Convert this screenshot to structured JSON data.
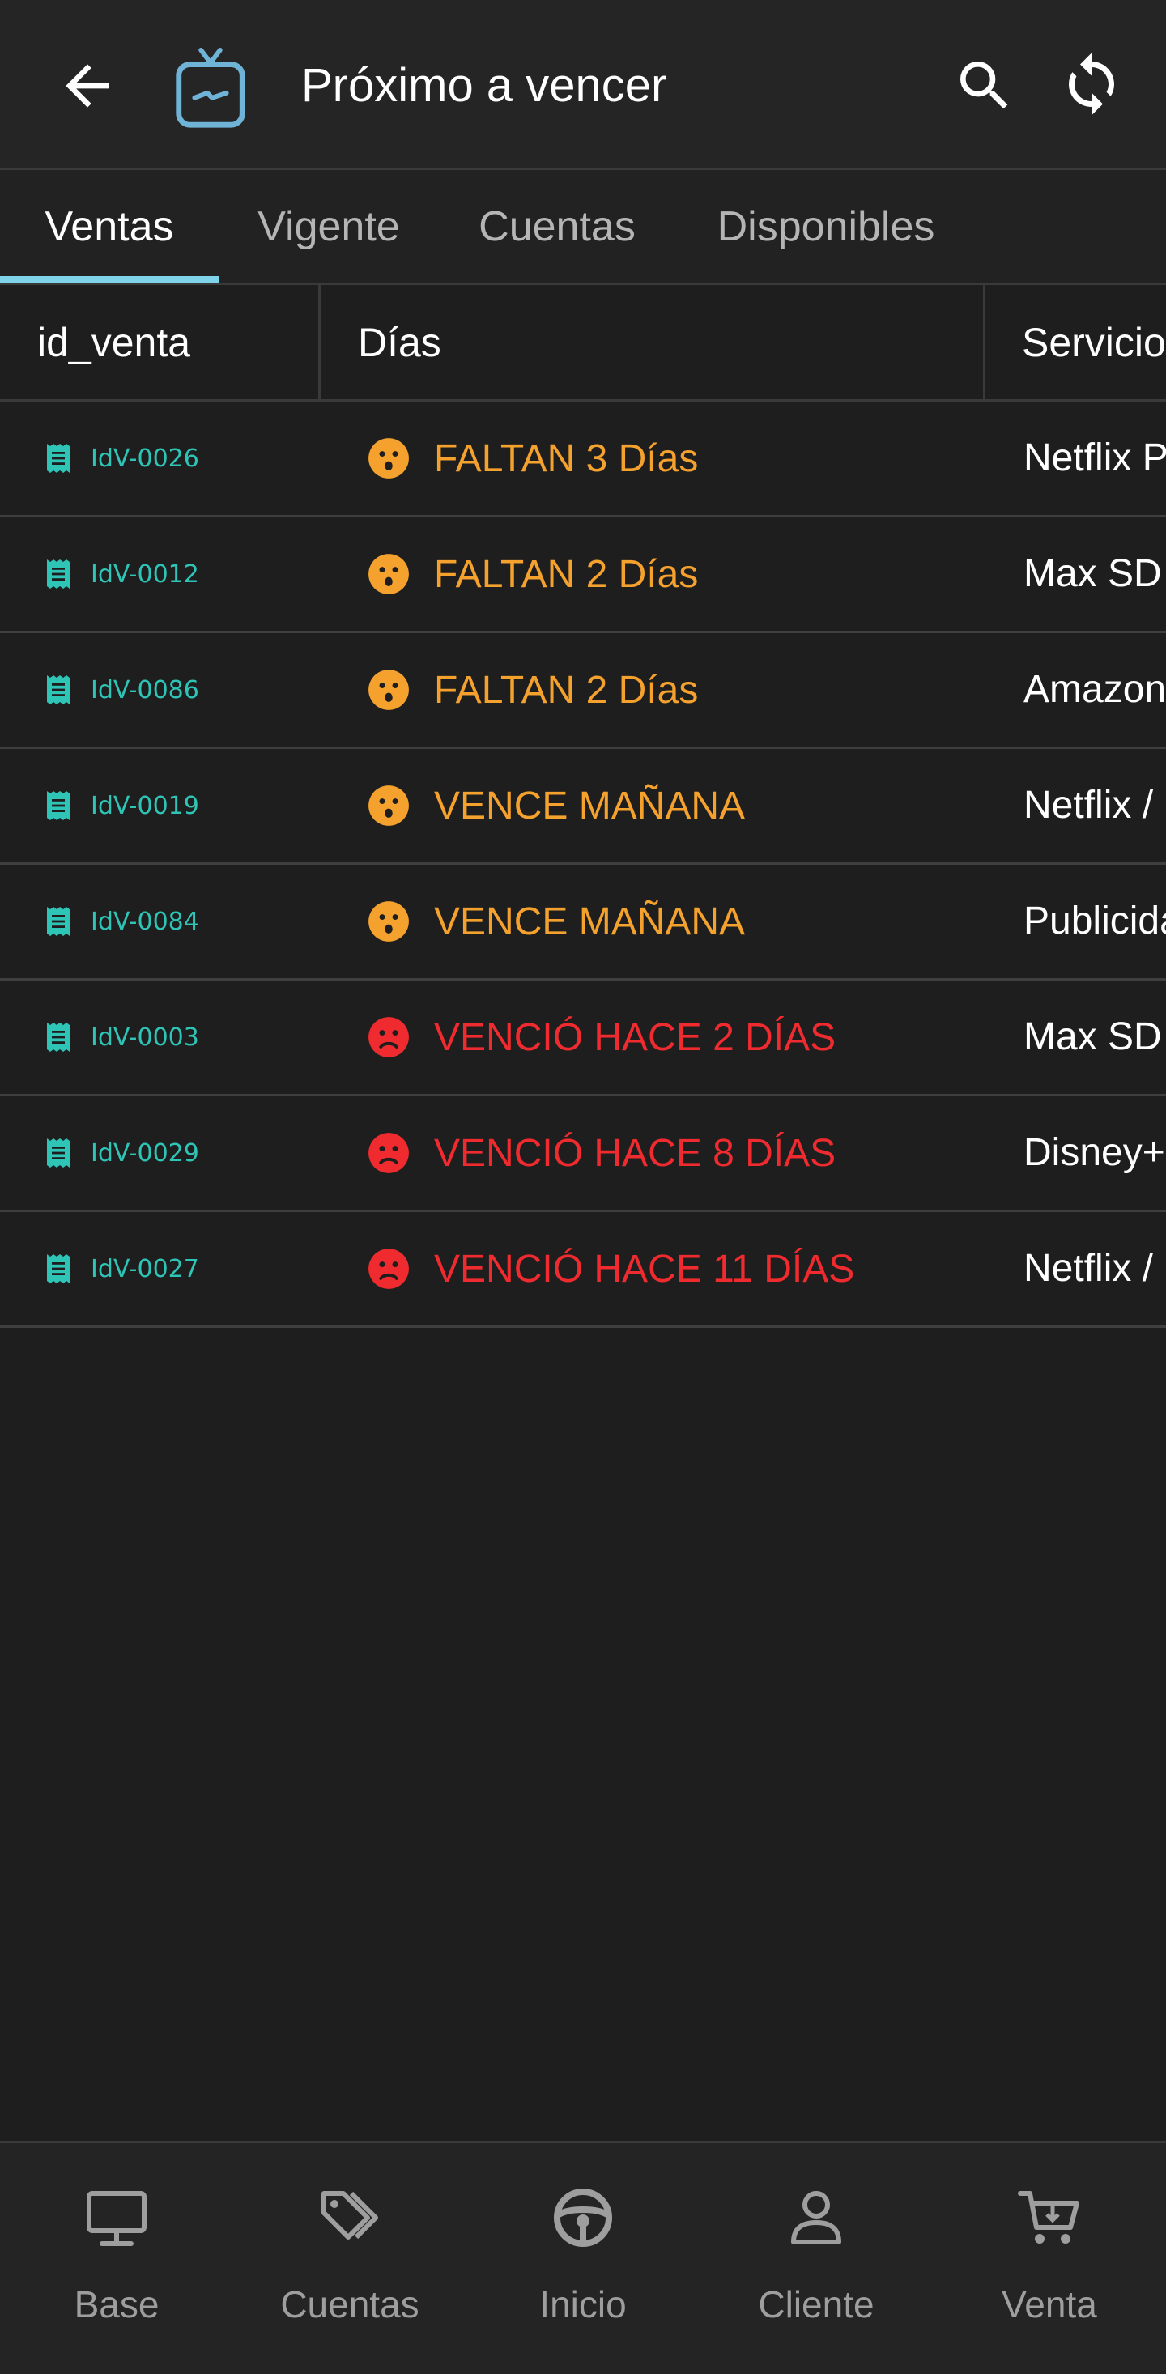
{
  "appbar": {
    "title": "Próximo a vencer",
    "back_icon": "arrow-left-icon",
    "logo_icon": "tv-icon",
    "search_icon": "search-icon",
    "refresh_icon": "sync-icon"
  },
  "tabs": [
    {
      "label": "Ventas",
      "active": true
    },
    {
      "label": "Vigente",
      "active": false
    },
    {
      "label": "Cuentas",
      "active": false
    },
    {
      "label": "Disponibles",
      "active": false
    }
  ],
  "table": {
    "columns": [
      "id_venta",
      "Días",
      "Servicio"
    ],
    "rows": [
      {
        "id": "IdV-0026",
        "dias": "FALTAN 3 Días",
        "status": "soon",
        "servicio": "Netflix Premium"
      },
      {
        "id": "IdV-0012",
        "dias": "FALTAN 2 Días",
        "status": "soon",
        "servicio": "Max SD"
      },
      {
        "id": "IdV-0086",
        "dias": "FALTAN 2 Días",
        "status": "soon",
        "servicio": "Amazon Prime"
      },
      {
        "id": "IdV-0019",
        "dias": "VENCE MAÑANA",
        "status": "soon",
        "servicio": "Netflix / Max"
      },
      {
        "id": "IdV-0084",
        "dias": "VENCE MAÑANA",
        "status": "soon",
        "servicio": "Publicidad"
      },
      {
        "id": "IdV-0003",
        "dias": "VENCIÓ HACE 2 DÍAS",
        "status": "expired",
        "servicio": "Max SD"
      },
      {
        "id": "IdV-0029",
        "dias": "VENCIÓ HACE 8 DÍAS",
        "status": "expired",
        "servicio": "Disney+"
      },
      {
        "id": "IdV-0027",
        "dias": "VENCIÓ HACE 11 DÍAS",
        "status": "expired",
        "servicio": "Netflix / Max"
      }
    ]
  },
  "bottom_nav": [
    {
      "label": "Base",
      "icon": "monitor-icon"
    },
    {
      "label": "Cuentas",
      "icon": "tags-icon"
    },
    {
      "label": "Inicio",
      "icon": "steering-wheel-icon"
    },
    {
      "label": "Cliente",
      "icon": "user-icon"
    },
    {
      "label": "Venta",
      "icon": "cart-icon"
    }
  ],
  "colors": {
    "accent": "#80d4ea",
    "id_text": "#2ec4b6",
    "soon": "#f4a12e",
    "expired": "#ef2b2f",
    "background": "#1e1e1e"
  }
}
